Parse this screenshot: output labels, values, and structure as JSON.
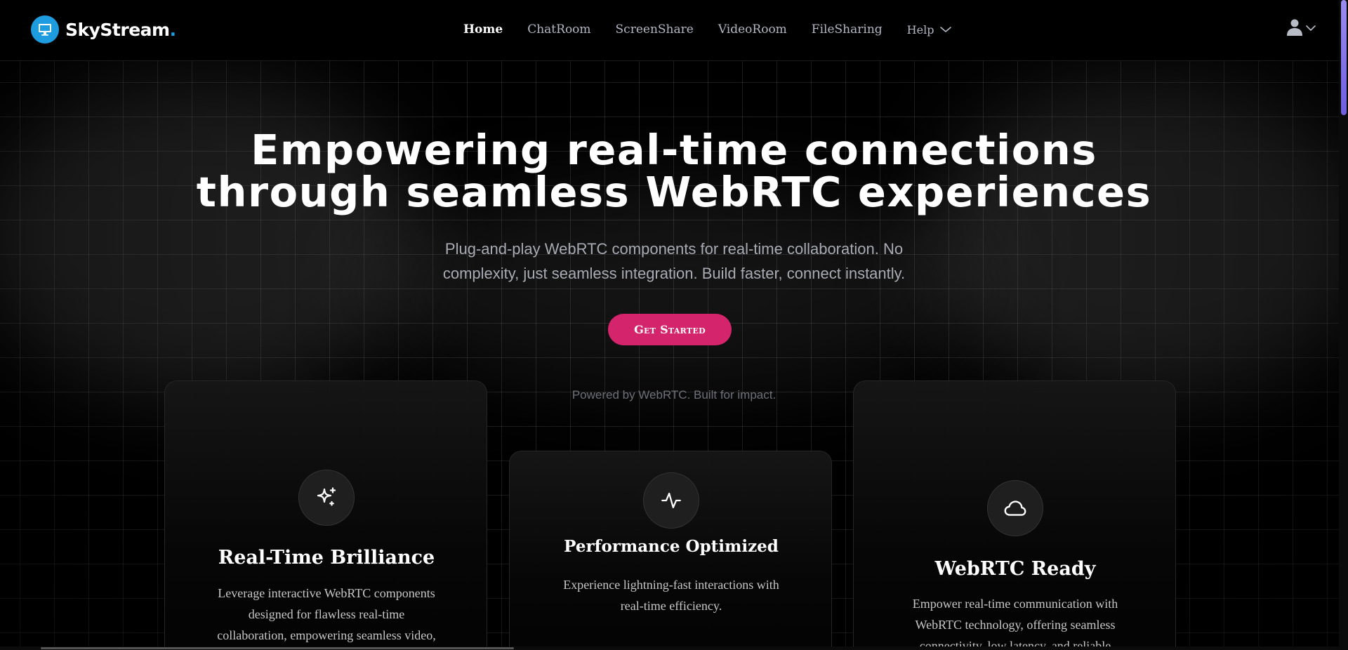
{
  "header": {
    "brand_name": "SkyStream",
    "brand_dot": ".",
    "nav": [
      {
        "label": "Home",
        "active": true
      },
      {
        "label": "ChatRoom"
      },
      {
        "label": "ScreenShare"
      },
      {
        "label": "VideoRoom"
      },
      {
        "label": "FileSharing"
      }
    ],
    "help_label": "Help",
    "user_icon": "user-icon",
    "help_icon": "chevron-down-icon"
  },
  "hero": {
    "title_line1": "Empowering real-time connections",
    "title_line2": "through seamless WebRTC experiences",
    "subtitle_line1": "Plug-and-play WebRTC components for real-time collaboration. No",
    "subtitle_line2": "complexity, just seamless integration. Build faster, connect instantly.",
    "cta_label": "Get Started",
    "tagline": "Powered by WebRTC. Built for impact."
  },
  "features": [
    {
      "icon": "sparkles-icon",
      "title": "Real-Time Brilliance",
      "desc_lines": [
        "Leverage interactive WebRTC components",
        "designed for flawless real-time",
        "collaboration, empowering seamless video,"
      ]
    },
    {
      "icon": "activity-icon",
      "title": "Performance Optimized",
      "desc_lines": [
        "Experience lightning-fast interactions with",
        "real-time efficiency."
      ]
    },
    {
      "icon": "cloud-icon",
      "title": "WebRTC Ready",
      "desc_lines": [
        "Empower real-time communication with",
        "WebRTC technology, offering seamless",
        "connectivity, low latency, and reliable"
      ]
    }
  ],
  "colors": {
    "brand_blue": "#1e9ce0",
    "cta_pink": "#d4246c",
    "background": "#000000"
  }
}
